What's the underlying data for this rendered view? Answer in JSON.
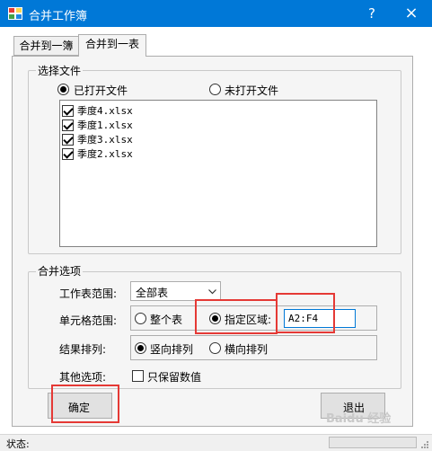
{
  "window": {
    "title": "合并工作簿",
    "help_label": "?",
    "close_label": "×"
  },
  "tabs": [
    {
      "label": "合并到一簿"
    },
    {
      "label": "合并到一表"
    }
  ],
  "file_group": {
    "label": "选择文件",
    "radio_opened": "已打开文件",
    "radio_unopened": "未打开文件",
    "files": [
      "季度4.xlsx",
      "季度1.xlsx",
      "季度3.xlsx",
      "季度2.xlsx"
    ]
  },
  "merge_group": {
    "label": "合并选项",
    "sheet_range_label": "工作表范围:",
    "sheet_range_value": "全部表",
    "cell_range_label": "单元格范围:",
    "whole_sheet": "整个表",
    "specified_area": "指定区域:",
    "area_value": "A2:F4",
    "sort_label": "结果排列:",
    "sort_vertical": "竖向排列",
    "sort_horizontal": "横向排列",
    "other_label": "其他选项:",
    "values_only": "只保留数值"
  },
  "buttons": {
    "ok": "确定",
    "exit": "退出"
  },
  "status": {
    "label": "状态:"
  },
  "watermark": "Baidu 经验"
}
